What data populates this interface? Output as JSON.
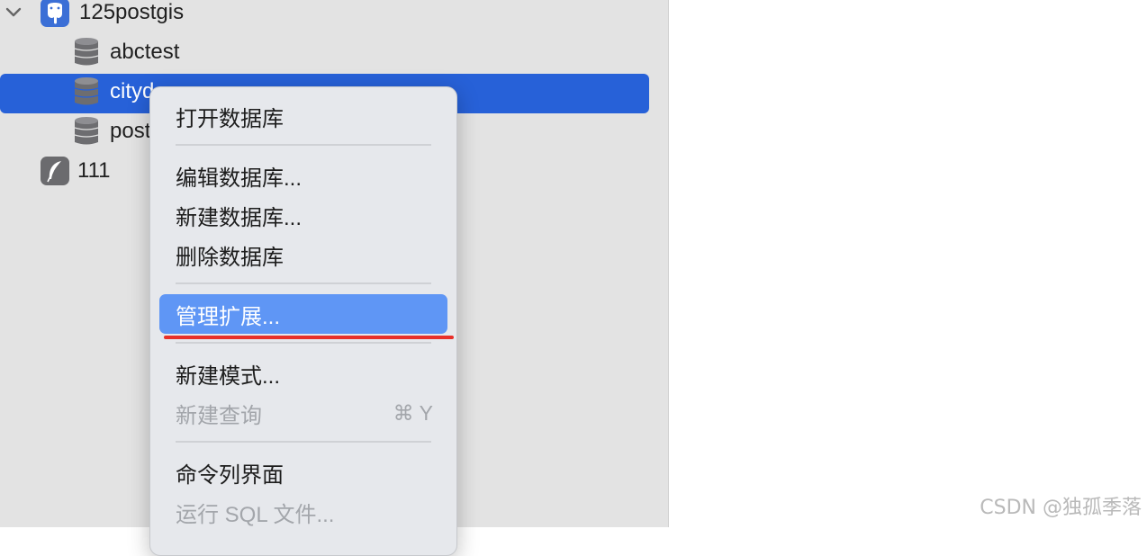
{
  "tree": {
    "connection": {
      "label": "125postgis",
      "icon": "postgres-elephant-icon"
    },
    "databases": [
      {
        "label": "abctest",
        "icon": "database-icon"
      },
      {
        "label": "cityd",
        "icon": "database-icon",
        "selected": true
      },
      {
        "label": "post",
        "icon": "database-icon"
      }
    ],
    "other_connection": {
      "label": "111",
      "icon": "feather-icon"
    }
  },
  "context_menu": {
    "items": [
      {
        "label": "打开数据库"
      },
      {
        "label": "编辑数据库..."
      },
      {
        "label": "新建数据库..."
      },
      {
        "label": "删除数据库"
      },
      {
        "label": "管理扩展...",
        "highlighted": true
      },
      {
        "label": "新建模式..."
      },
      {
        "label": "新建查询",
        "disabled": true,
        "shortcut": "⌘ Y"
      },
      {
        "label": "命令列界面"
      },
      {
        "label": "运行 SQL 文件...",
        "disabled": true
      }
    ]
  },
  "colors": {
    "selection": "#2761d8",
    "menu_highlight": "#5f96f5",
    "annotation_underline": "#e8302a"
  },
  "watermark": "CSDN @独孤季落"
}
